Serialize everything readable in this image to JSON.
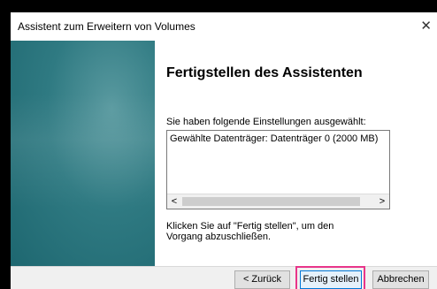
{
  "window": {
    "title": "Assistent zum Erweitern von Volumes",
    "close_glyph": "✕"
  },
  "content": {
    "heading": "Fertigstellen des Assistenten",
    "selected_label": "Sie haben folgende Einstellungen ausgewählt:",
    "settings": [
      "Gewählte Datenträger: Datenträger 0 (2000 MB)"
    ],
    "finish_hint": "Klicken Sie auf \"Fertig stellen\", um den Vorgang abzuschließen."
  },
  "scrollbar": {
    "left_glyph": "<",
    "right_glyph": ">"
  },
  "buttons": {
    "back": "< Zurück",
    "finish": "Fertig stellen",
    "cancel": "Abbrechen"
  },
  "colors": {
    "side_panel": "#2f7a82",
    "highlight": "#e8358a",
    "default_button_border": "#0078d7"
  },
  "icons": {
    "close": "close-icon"
  }
}
